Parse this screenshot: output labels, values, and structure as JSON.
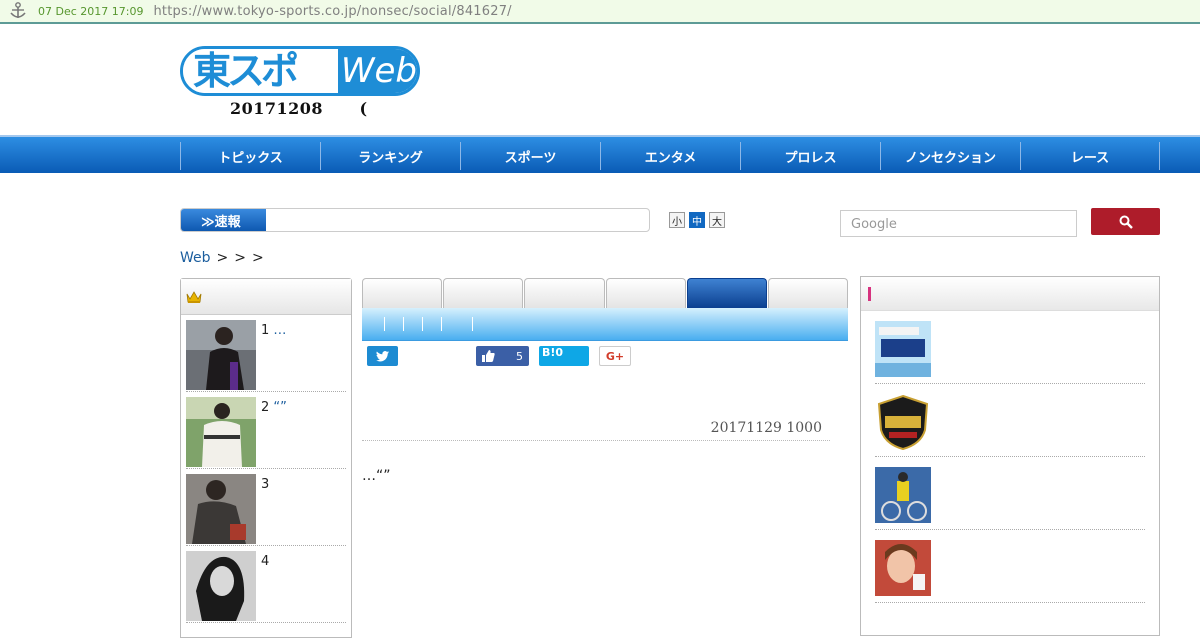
{
  "archive": {
    "date": "07 Dec 2017 17:09",
    "url": "https://www.tokyo-sports.co.jp/nonsec/social/841627/"
  },
  "header": {
    "logo_jp": "東スポ",
    "logo_web": "Web",
    "date_text": "20171208",
    "date_paren": "("
  },
  "nav": {
    "items": [
      "トピックス",
      "ランキング",
      "スポーツ",
      "エンタメ",
      "プロレス",
      "ノンセクション",
      "レース"
    ]
  },
  "breaking": {
    "label": "≫速報"
  },
  "font_size": {
    "small": "小",
    "medium": "中",
    "large": "大"
  },
  "search": {
    "placeholder": "Google"
  },
  "breadcrumb": {
    "home": "Web",
    "sep": ">"
  },
  "ranking": {
    "items": [
      {
        "num": "1",
        "title": "…"
      },
      {
        "num": "2",
        "title": "“”"
      },
      {
        "num": "3",
        "title": ""
      },
      {
        "num": "4",
        "title": ""
      }
    ]
  },
  "share": {
    "facebook_count": "5",
    "hatena": "B!0",
    "gplus": "G+"
  },
  "article": {
    "date": "20171129 1000",
    "body": "…“”"
  },
  "colors": {
    "nav_blue": "#0a5bb5",
    "search_button": "#ae1c2a",
    "logo_blue": "#1e8dd6",
    "accent_pink": "#d6337f"
  }
}
